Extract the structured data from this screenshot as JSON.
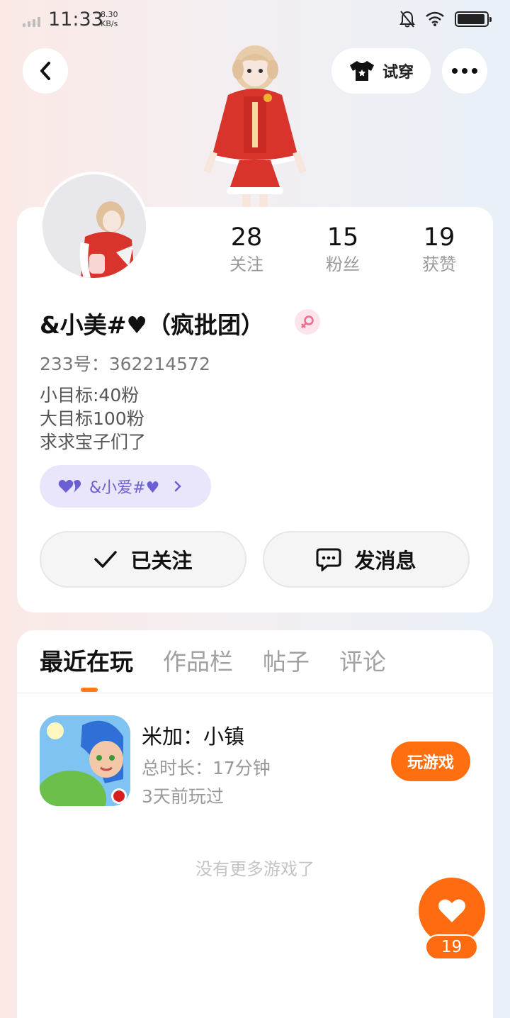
{
  "status_bar": {
    "time": "11:33",
    "net_speed_value": "8.30",
    "net_speed_unit": "KB/s",
    "icons": [
      "signal-icon",
      "mute-bell-icon",
      "wifi-icon",
      "battery-icon"
    ],
    "battery_level": 0.95
  },
  "header": {
    "back_icon": "chevron-left-icon",
    "try_on_label": "试穿",
    "try_on_icon": "tshirt-icon",
    "more_icon": "more-dots-icon"
  },
  "profile": {
    "stats": [
      {
        "value": "28",
        "label": "关注"
      },
      {
        "value": "15",
        "label": "粉丝"
      },
      {
        "value": "19",
        "label": "获赞"
      }
    ],
    "nickname": "&小美#♥（疯批团）",
    "gender_icon": "female-symbol-icon",
    "uid": "233号：362214572",
    "bio_lines": [
      "小目标:40粉",
      "大目标100粉",
      "求求宝子们了"
    ],
    "friend_tag": "&小爱#♥",
    "follow_label": "已关注",
    "message_label": "发消息"
  },
  "tabs": [
    {
      "label": "最近在玩",
      "active": true
    },
    {
      "label": "作品栏",
      "active": false
    },
    {
      "label": "帖子",
      "active": false
    },
    {
      "label": "评论",
      "active": false
    }
  ],
  "recent_games": [
    {
      "name": "米加：小镇",
      "duration": "总时长：17分钟",
      "last_played": "3天前玩过",
      "play_label": "玩游戏"
    }
  ],
  "no_more_text": "没有更多游戏了",
  "like": {
    "count": "19"
  },
  "colors": {
    "accent_orange": "#ff6b10",
    "tag_purple": "#6b5fd4",
    "tag_bg": "#e9e6fb",
    "female_pink": "#f06a8a"
  }
}
